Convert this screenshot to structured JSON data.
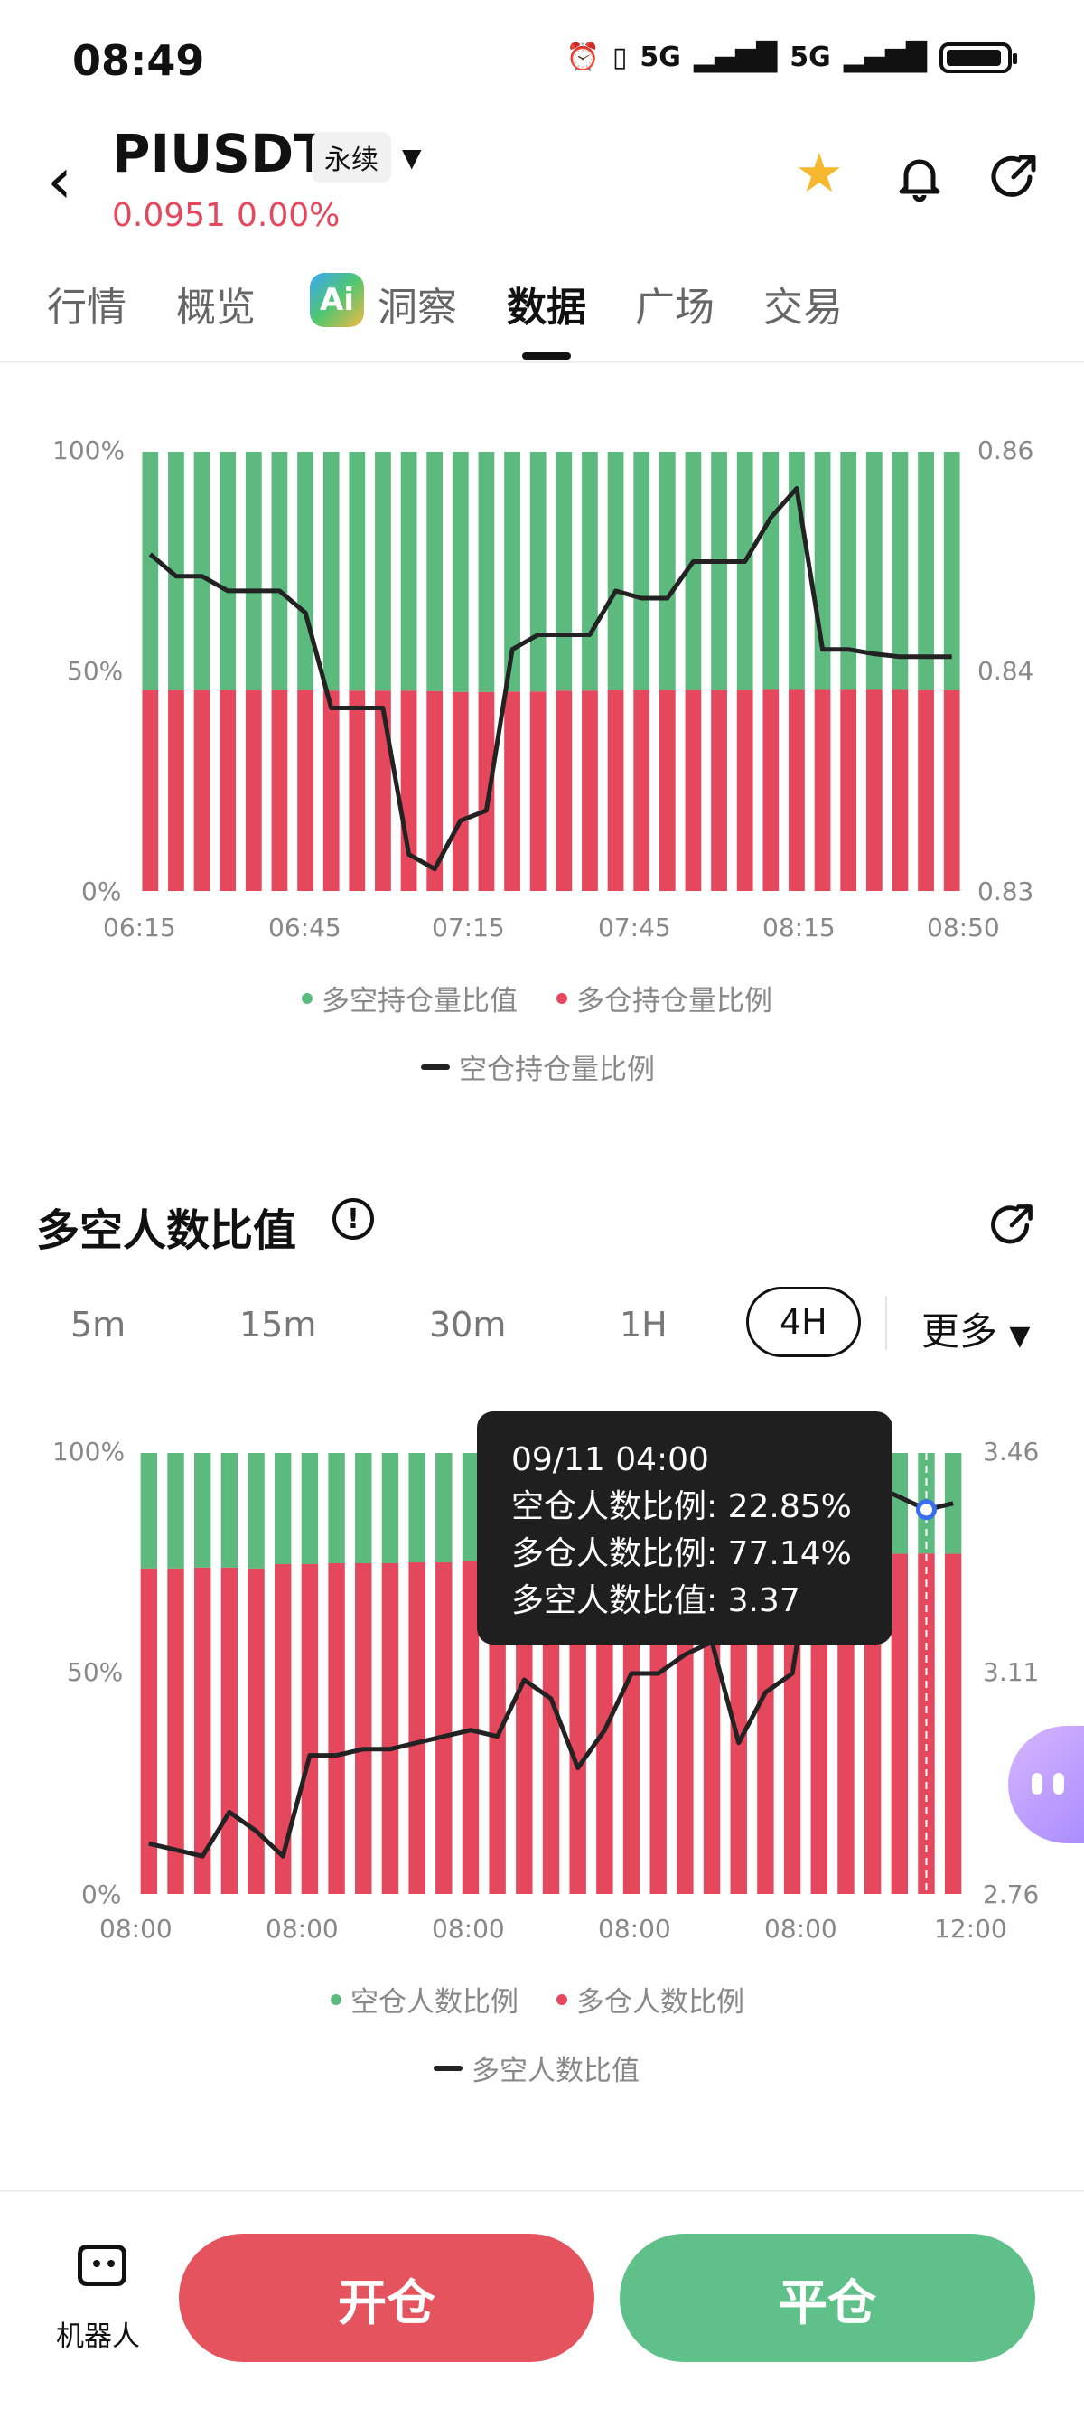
{
  "status_bar": {
    "time": "08:49",
    "net1": "5G",
    "net2": "5G"
  },
  "header": {
    "symbol": "PIUSDT",
    "badge": "永续",
    "price": "0.0951",
    "change": "0.00%"
  },
  "tabs": [
    {
      "label": "行情"
    },
    {
      "label": "概览"
    },
    {
      "label": "洞察"
    },
    {
      "label": "数据"
    },
    {
      "label": "广场"
    },
    {
      "label": "交易"
    }
  ],
  "active_tab": "数据",
  "chart1": {
    "left_ticks": [
      "100%",
      "50%",
      "0%"
    ],
    "right_ticks": [
      "0.86",
      "0.84",
      "0.83"
    ],
    "x_ticks": [
      "06:15",
      "06:45",
      "07:15",
      "07:45",
      "08:15",
      "08:50"
    ],
    "legend": [
      "多空持仓量比值",
      "多仓持仓量比例",
      "空仓持仓量比例"
    ]
  },
  "section2": {
    "title": "多空人数比值",
    "periods": [
      "5m",
      "15m",
      "30m",
      "1H",
      "4H"
    ],
    "active_period": "4H",
    "more_label": "更多"
  },
  "chart2": {
    "left_ticks": [
      "100%",
      "50%",
      "0%"
    ],
    "right_ticks": [
      "3.46",
      "3.11",
      "2.76"
    ],
    "x_ticks": [
      "08:00",
      "08:00",
      "08:00",
      "08:00",
      "08:00",
      "12:00"
    ],
    "legend": [
      "空仓人数比例",
      "多仓人数比例",
      "多空人数比值"
    ]
  },
  "tooltip": {
    "date": "09/11 04:00",
    "short_ratio": "空仓人数比例: 22.85%",
    "long_ratio": "多仓人数比例: 77.14%",
    "ls_ratio": "多空人数比值: 3.37"
  },
  "bottom": {
    "robot_label": "机器人",
    "open_label": "开仓",
    "close_label": "平仓"
  },
  "colors": {
    "green": "#5cba7f",
    "red": "#e5475d",
    "line": "#222222"
  },
  "chart_data": [
    {
      "type": "bar",
      "stacked": true,
      "secondary_line": true,
      "x_ticks": [
        "06:15",
        "06:45",
        "07:15",
        "07:45",
        "08:15",
        "08:50"
      ],
      "ylim_left": [
        0,
        100
      ],
      "ylim_right": [
        0.83,
        0.86
      ],
      "series": [
        {
          "name": "多仓持仓量比例",
          "color": "#e5475d",
          "values": [
            45.7,
            45.7,
            45.7,
            45.7,
            45.7,
            45.7,
            45.7,
            45.6,
            45.6,
            45.6,
            45.6,
            45.5,
            45.3,
            45.3,
            45.4,
            45.4,
            45.6,
            45.6,
            45.7,
            45.7,
            45.7,
            45.7,
            45.7,
            45.7,
            45.8,
            45.8,
            45.8,
            45.8,
            45.8,
            45.8,
            45.7,
            45.7
          ]
        },
        {
          "name": "多空持仓量比值",
          "color": "#5cba7f",
          "values": [
            54.3,
            54.3,
            54.3,
            54.3,
            54.3,
            54.3,
            54.3,
            54.4,
            54.4,
            54.4,
            54.4,
            54.5,
            54.7,
            54.7,
            54.6,
            54.6,
            54.4,
            54.4,
            54.3,
            54.3,
            54.3,
            54.3,
            54.3,
            54.3,
            54.2,
            54.2,
            54.2,
            54.2,
            54.2,
            54.2,
            54.3,
            54.3
          ]
        },
        {
          "name": "空仓持仓量比例",
          "type": "line",
          "axis": "right",
          "values": [
            0.853,
            0.8515,
            0.8515,
            0.8505,
            0.8505,
            0.8505,
            0.849,
            0.8425,
            0.8425,
            0.8425,
            0.8325,
            0.8315,
            0.8348,
            0.8355,
            0.8465,
            0.8475,
            0.8475,
            0.8475,
            0.8505,
            0.85,
            0.85,
            0.8525,
            0.8525,
            0.8525,
            0.8555,
            0.8575,
            0.8465,
            0.8465,
            0.8462,
            0.846,
            0.846,
            0.846
          ]
        }
      ]
    },
    {
      "type": "bar",
      "stacked": true,
      "secondary_line": true,
      "x_ticks": [
        "08:00",
        "08:00",
        "08:00",
        "08:00",
        "08:00",
        "12:00"
      ],
      "ylim_left": [
        0,
        100
      ],
      "ylim_right": [
        2.76,
        3.46
      ],
      "series": [
        {
          "name": "多仓人数比例",
          "color": "#e5475d",
          "values": [
            73.8,
            73.8,
            74.0,
            74.0,
            73.8,
            74.8,
            74.8,
            75.0,
            75.0,
            75.0,
            75.2,
            75.2,
            75.5,
            75.5,
            75.4,
            75.8,
            75.8,
            76.0,
            76.2,
            76.3,
            76.5,
            76.6,
            76.8,
            76.9,
            77.0,
            77.1,
            77.1,
            77.14,
            77.14,
            77.2,
            77.14
          ]
        },
        {
          "name": "空仓人数比例",
          "color": "#5cba7f",
          "values": [
            26.2,
            26.2,
            26.0,
            26.0,
            26.2,
            25.2,
            25.2,
            25.0,
            25.0,
            25.0,
            24.8,
            24.8,
            24.5,
            24.5,
            24.6,
            24.2,
            24.2,
            24.0,
            23.8,
            23.7,
            23.5,
            23.4,
            23.2,
            23.1,
            23.0,
            22.9,
            22.9,
            22.86,
            22.86,
            22.8,
            22.86
          ]
        },
        {
          "name": "多空人数比值",
          "type": "line",
          "axis": "right",
          "values": [
            2.84,
            2.83,
            2.82,
            2.89,
            2.86,
            2.82,
            2.98,
            2.98,
            2.99,
            2.99,
            3.0,
            3.01,
            3.02,
            3.01,
            3.1,
            3.07,
            2.96,
            3.02,
            3.11,
            3.11,
            3.14,
            3.16,
            3.0,
            3.08,
            3.11,
            3.38,
            3.39,
            3.41,
            3.39,
            3.37,
            3.38
          ]
        }
      ]
    }
  ]
}
